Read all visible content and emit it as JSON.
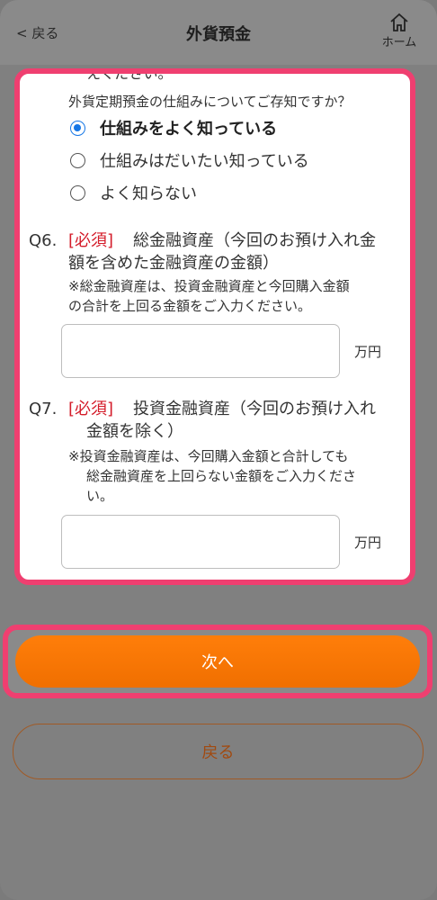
{
  "header": {
    "back_label": "< 戻る",
    "title": "外貨預金",
    "home_label": "ホーム"
  },
  "q5": {
    "cut_text": "えください。",
    "prompt": "外貨定期預金の仕組みについてご存知ですか？",
    "options": [
      {
        "label": "仕組みをよく知っている",
        "selected": true
      },
      {
        "label": "仕組みはだいたい知っている",
        "selected": false
      },
      {
        "label": "よく知らない",
        "selected": false
      }
    ]
  },
  "q6": {
    "number": "Q6.",
    "required": "[必須]",
    "text_line1": "総金融資産（今回のお預け入れ金",
    "text_line2": "額を含めた金融資産の金額）",
    "note_line1": "※総金融資産は、投資金融資産と今回購入金額",
    "note_line2": "の合計を上回る金額をご入力ください。",
    "value": "",
    "unit": "万円"
  },
  "q7": {
    "number": "Q7.",
    "required": "[必須]",
    "text_line1": "投資金融資産（今回のお預け入れ",
    "text_line2": "金額を除く）",
    "note_line1": "※投資金融資産は、今回購入金額と合計しても",
    "note_line2": "総金融資産を上回らない金額をご入力くださ",
    "note_line3": "い。",
    "value": "",
    "unit": "万円"
  },
  "buttons": {
    "next_label": "次へ",
    "back_label": "戻る"
  },
  "colors": {
    "accent": "#ef3f70",
    "primary": "#f37a06",
    "radio": "#1677e6",
    "required": "#d41c2a"
  }
}
